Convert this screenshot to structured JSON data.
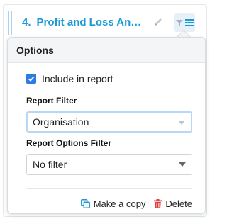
{
  "card": {
    "number": "4.",
    "title": "Profit and Loss Analy..."
  },
  "icons": {
    "drag": "drag-handle-icon",
    "edit": "pencil-icon",
    "filter": "filter-icon",
    "menu": "hamburger-menu-icon",
    "check": "checkmark-icon",
    "copy": "copy-icon",
    "delete": "trash-icon"
  },
  "colors": {
    "title": "#1a9ad6",
    "checkbox": "#2b7be0",
    "delete_icon": "#e0403a",
    "copy_icon": "#1a9ad6",
    "focus_border": "#b7d7f4"
  },
  "options": {
    "heading": "Options",
    "include_in_report": {
      "label": "Include in report",
      "checked": true
    },
    "report_filter": {
      "label": "Report Filter",
      "value": "Organisation"
    },
    "report_options_filter": {
      "label": "Report Options Filter",
      "value": "No filter"
    },
    "make_copy_label": "Make a copy",
    "delete_label": "Delete"
  }
}
